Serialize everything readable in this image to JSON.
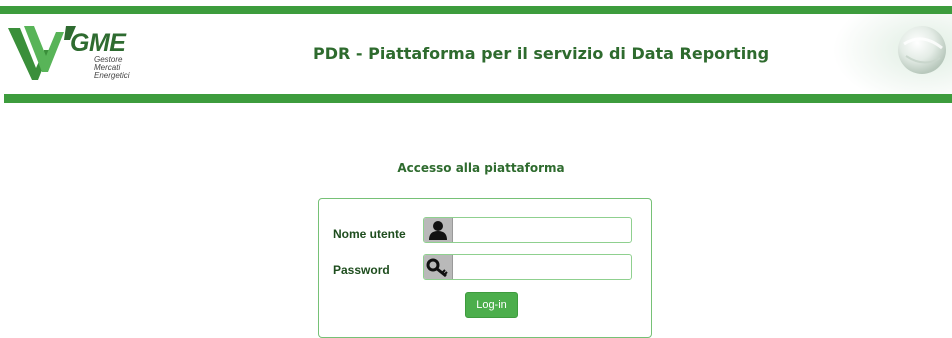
{
  "colors": {
    "brand_green": "#3d9c3d",
    "title_green": "#2e6b2e",
    "button_green": "#4cae4c",
    "box_border": "#76c176"
  },
  "logo": {
    "word": "GME",
    "sub_lines": [
      "Gestore",
      "Mercati",
      "Energetici"
    ]
  },
  "header": {
    "title": "PDR - Piattaforma per il servizio di Data Reporting"
  },
  "login": {
    "section_title": "Accesso alla piattaforma",
    "username_label": "Nome utente",
    "username_icon": "user-icon",
    "username_value": "",
    "password_label": "Password",
    "password_icon": "key-icon",
    "password_value": "",
    "submit_label": "Log-in"
  }
}
